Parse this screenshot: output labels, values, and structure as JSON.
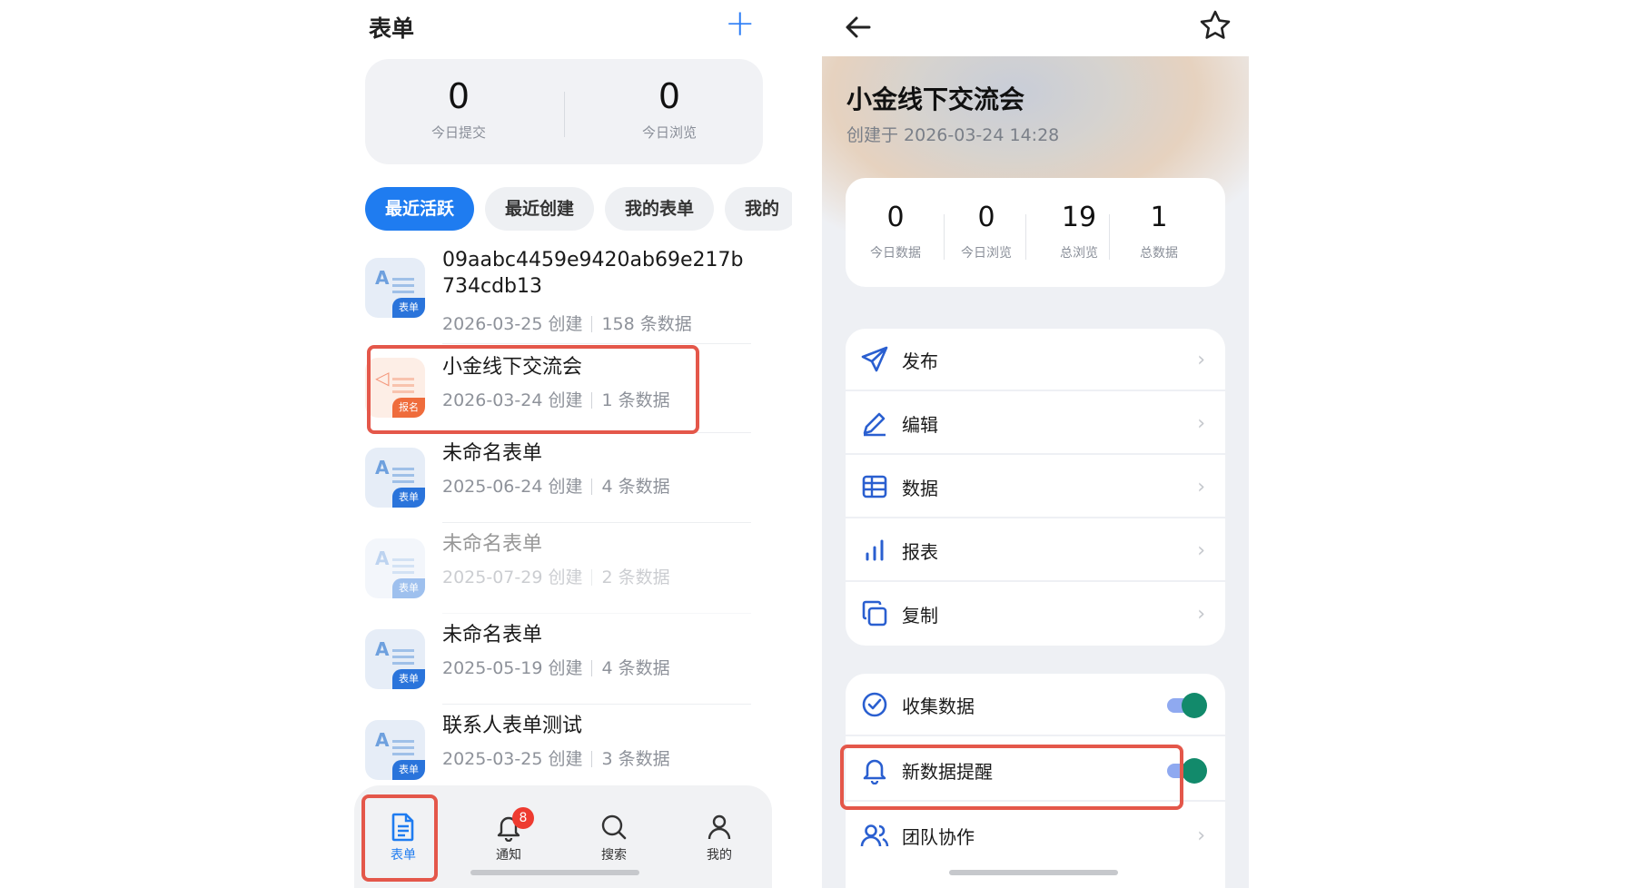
{
  "left": {
    "title": "表单",
    "add_icon": "plus-icon",
    "stats": [
      {
        "value": "0",
        "label": "今日提交"
      },
      {
        "value": "0",
        "label": "今日浏览"
      }
    ],
    "tabs": [
      "最近活跃",
      "最近创建",
      "我的表单",
      "我的"
    ],
    "items": [
      {
        "title": "09aabc4459e9420ab69e217b734cdb13",
        "created": "2026-03-25 创建",
        "count": "158 条数据",
        "tag": "表单"
      },
      {
        "title": "小金线下交流会",
        "created": "2026-03-24 创建",
        "count": "1 条数据",
        "tag": "报名"
      },
      {
        "title": "未命名表单",
        "created": "2025-06-24 创建",
        "count": "4 条数据",
        "tag": "表单"
      },
      {
        "title": "未命名表单",
        "created": "2025-07-29 创建",
        "count": "2 条数据",
        "tag": "表单"
      },
      {
        "title": "未命名表单",
        "created": "2025-05-19 创建",
        "count": "4 条数据",
        "tag": "表单"
      },
      {
        "title": "联系人表单测试",
        "created": "2025-03-25 创建",
        "count": "3 条数据",
        "tag": "表单"
      }
    ],
    "nav": [
      {
        "label": "表单",
        "icon": "document-icon"
      },
      {
        "label": "通知",
        "icon": "bell-icon",
        "badge": "8"
      },
      {
        "label": "搜索",
        "icon": "search-icon"
      },
      {
        "label": "我的",
        "icon": "user-icon"
      }
    ]
  },
  "right": {
    "name": "小金线下交流会",
    "created": "创建于 2026-03-24 14:28",
    "stats": [
      {
        "value": "0",
        "label": "今日数据"
      },
      {
        "value": "0",
        "label": "今日浏览"
      },
      {
        "value": "19",
        "label": "总浏览"
      },
      {
        "value": "1",
        "label": "总数据"
      }
    ],
    "menu": [
      {
        "label": "发布",
        "icon": "send-icon"
      },
      {
        "label": "编辑",
        "icon": "pencil-icon"
      },
      {
        "label": "数据",
        "icon": "table-icon"
      },
      {
        "label": "报表",
        "icon": "bar-chart-icon"
      },
      {
        "label": "复制",
        "icon": "copy-icon"
      }
    ],
    "settings": [
      {
        "label": "收集数据",
        "icon": "check-circle-icon",
        "enabled": true
      },
      {
        "label": "新数据提醒",
        "icon": "bell-icon",
        "enabled": true
      },
      {
        "label": "团队协作",
        "icon": "users-icon"
      }
    ]
  },
  "colors": {
    "accent": "#1f7cf0",
    "highlight": "#e4574a",
    "toggle_on": "#128a6b",
    "badge": "#ee3b30"
  }
}
